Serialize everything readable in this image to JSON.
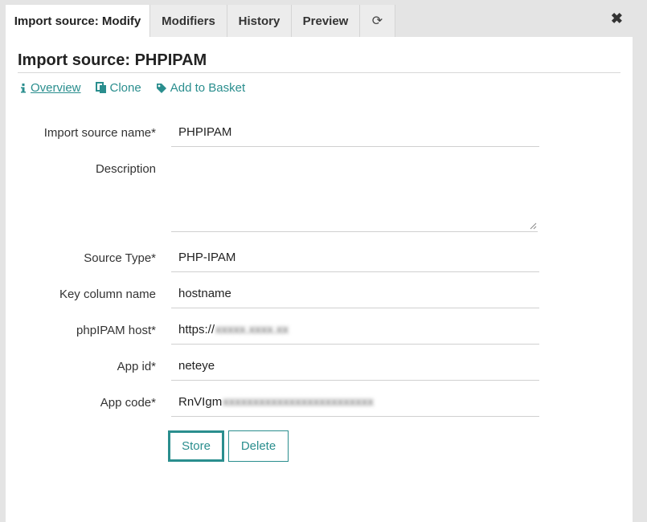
{
  "tabs": [
    {
      "label": "Import source: Modify"
    },
    {
      "label": "Modifiers"
    },
    {
      "label": "History"
    },
    {
      "label": "Preview"
    }
  ],
  "refresh_icon": "⟳",
  "close_icon": "✖",
  "page_title": "Import source: PHPIPAM",
  "actions": {
    "overview": "Overview",
    "clone": "Clone",
    "add_to_basket": "Add to Basket"
  },
  "form": {
    "import_source_name_label": "Import source name*",
    "import_source_name_value": "PHPIPAM",
    "description_label": "Description",
    "description_value": "",
    "source_type_label": "Source Type*",
    "source_type_value": "PHP-IPAM",
    "key_column_label": "Key column name",
    "key_column_value": "hostname",
    "host_label": "phpIPAM host*",
    "host_value_prefix": "https://",
    "app_id_label": "App id*",
    "app_id_value": "neteye",
    "app_code_label": "App code*",
    "app_code_prefix": "RnVIgm"
  },
  "buttons": {
    "store": "Store",
    "delete": "Delete"
  },
  "colors": {
    "accent": "#2a8e8e",
    "background": "#e4e4e4"
  }
}
